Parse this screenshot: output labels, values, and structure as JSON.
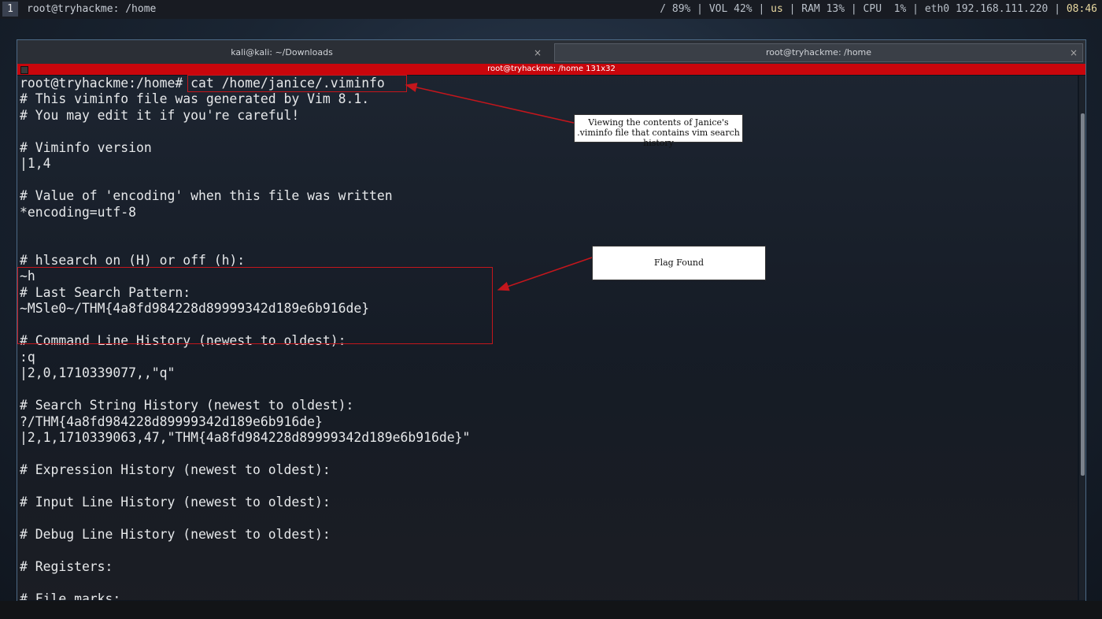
{
  "topbar": {
    "workspace": "1",
    "title": "root@tryhackme: /home",
    "status": {
      "disk": "/ 89%",
      "vol": "VOL 42%",
      "lang": "us",
      "ram": "RAM 13%",
      "cpu": "CPU  1%",
      "net": "eth0 192.168.111.220",
      "time": "08:46"
    }
  },
  "tabs": [
    {
      "label": "kali@kali: ~/Downloads",
      "close": "×"
    },
    {
      "label": "root@tryhackme: /home",
      "close": "×"
    }
  ],
  "titlebar": "root@tryhackme: /home 131x32",
  "terminal_lines": [
    "root@tryhackme:/home# cat /home/janice/.viminfo",
    "# This viminfo file was generated by Vim 8.1.",
    "# You may edit it if you're careful!",
    "",
    "# Viminfo version",
    "|1,4",
    "",
    "# Value of 'encoding' when this file was written",
    "*encoding=utf-8",
    "",
    "",
    "# hlsearch on (H) or off (h):",
    "~h",
    "# Last Search Pattern:",
    "~MSle0~/THM{4a8fd984228d89999342d189e6b916de}",
    "",
    "# Command Line History (newest to oldest):",
    ":q",
    "|2,0,1710339077,,\"q\"",
    "",
    "# Search String History (newest to oldest):",
    "?/THM{4a8fd984228d89999342d189e6b916de}",
    "|2,1,1710339063,47,\"THM{4a8fd984228d89999342d189e6b916de}\"",
    "",
    "# Expression History (newest to oldest):",
    "",
    "# Input Line History (newest to oldest):",
    "",
    "# Debug Line History (newest to oldest):",
    "",
    "# Registers:",
    "",
    "# File marks:"
  ],
  "annotations": {
    "note1": "Viewing the contents of Janice's .viminfo file that contains vim search history",
    "note2": "Flag Found"
  },
  "colors": {
    "accent_red": "#c9060c",
    "annotation_red": "#c4161c"
  }
}
